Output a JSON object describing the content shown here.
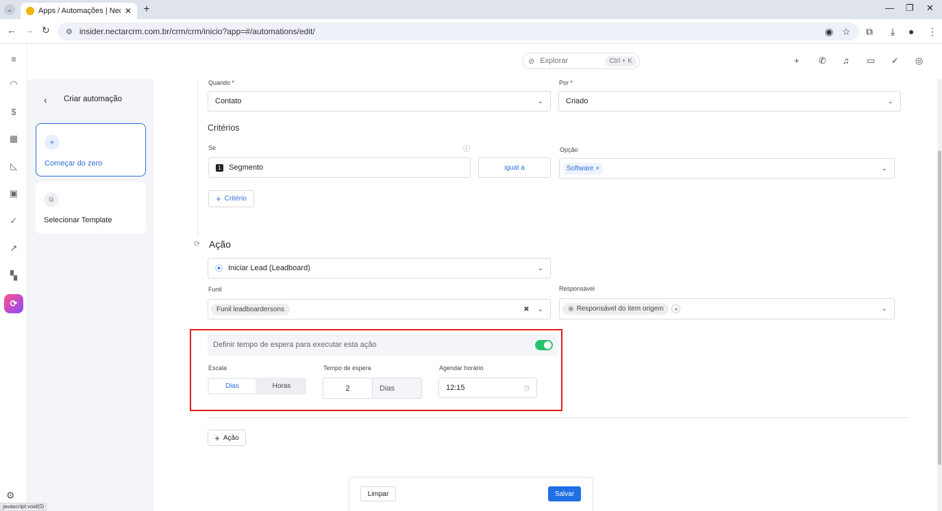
{
  "browser": {
    "tab_title": "Apps / Automações | NectarCR",
    "tab_close": "✕",
    "new_tab": "+",
    "url": "insider.nectarcrm.com.br/crm/crm/inicio?app=#/automations/edit/",
    "status_text": "javascript:void(0)"
  },
  "topbar": {
    "explore_label": "Explorar",
    "explore_shortcut": "Ctrl + K"
  },
  "left_panel": {
    "back_icon": "chevron-left-icon",
    "title": "Criar automação",
    "cards": [
      {
        "label": "Começar do zero",
        "icon": "plus-icon",
        "selected": true
      },
      {
        "label": "Selecionar Template",
        "icon": "template-icon",
        "selected": false
      }
    ]
  },
  "trigger": {
    "quando_label": "Quando *",
    "quando_value": "Contato",
    "por_label": "Por *",
    "por_value": "Criado"
  },
  "criteria": {
    "title": "Critérios",
    "se_label": "Se",
    "opcao_label": "Opção",
    "field_badge": "1",
    "field_value": "Segmento",
    "operator": "igual a",
    "option_chip": "Software",
    "add_button": "Critério"
  },
  "action": {
    "title": "Ação",
    "action_value": "Iniciar Lead (Leadboard)",
    "funil_label": "Funil",
    "funil_value": "Funil leadboardersons",
    "responsavel_label": "Responsável",
    "responsavel_value": "Responsável do item origem",
    "wait_toggle_label": "Definir tempo de espera para executar esta ação",
    "wait_enabled": true,
    "escala_label": "Escala",
    "escala_options": [
      "Dias",
      "Horas"
    ],
    "escala_selected": "Dias",
    "tempo_label": "Tempo de espera",
    "tempo_value": "2",
    "tempo_unit": "Dias",
    "agendar_label": "Agendar horário",
    "agendar_value": "12:15",
    "add_action_button": "Ação"
  },
  "footer": {
    "clear_button": "Limpar",
    "save_button": "Salvar"
  },
  "colors": {
    "accent": "#2b6fe0",
    "toggle_on": "#26c26b",
    "highlight_box": "#e01c1c"
  }
}
